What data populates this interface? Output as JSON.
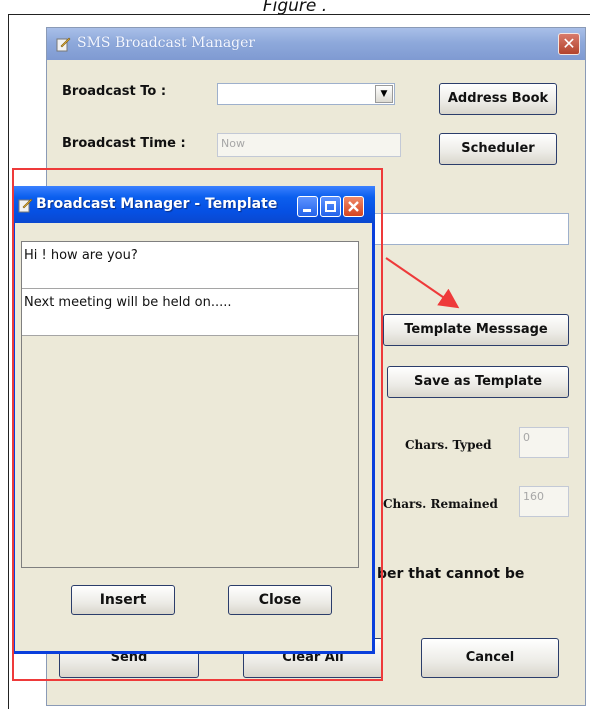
{
  "caption": "Figure .",
  "main_window": {
    "title": "SMS Broadcast Manager",
    "close_glyph": "✕",
    "broadcast_to_label": "Broadcast To :",
    "broadcast_to_value": "",
    "address_book_button": "Address Book",
    "broadcast_time_label": "Broadcast Time :",
    "broadcast_time_value": "Now",
    "scheduler_button": "Scheduler",
    "message_field_value": "",
    "template_message_button": "Template Messsage",
    "save_as_template_button": "Save as Template",
    "chars_typed_label": "Chars. Typed",
    "chars_typed_value": "0",
    "chars_remained_label": "Chars. Remained",
    "chars_remained_value": "160",
    "warning_text_visible": "ber that cannot be",
    "send_button": "Send",
    "clear_all_button": "Clear All",
    "cancel_button": "Cancel"
  },
  "template_window": {
    "title": "Broadcast Manager - Template",
    "templates": [
      "Hi ! how are you?",
      "Next meeting will be held  on....."
    ],
    "insert_button": "Insert",
    "close_button": "Close"
  },
  "colors": {
    "annotation_red": "#ee3a3a",
    "xp_blue": "#0a3fdc",
    "window_face": "#ece9d8"
  }
}
